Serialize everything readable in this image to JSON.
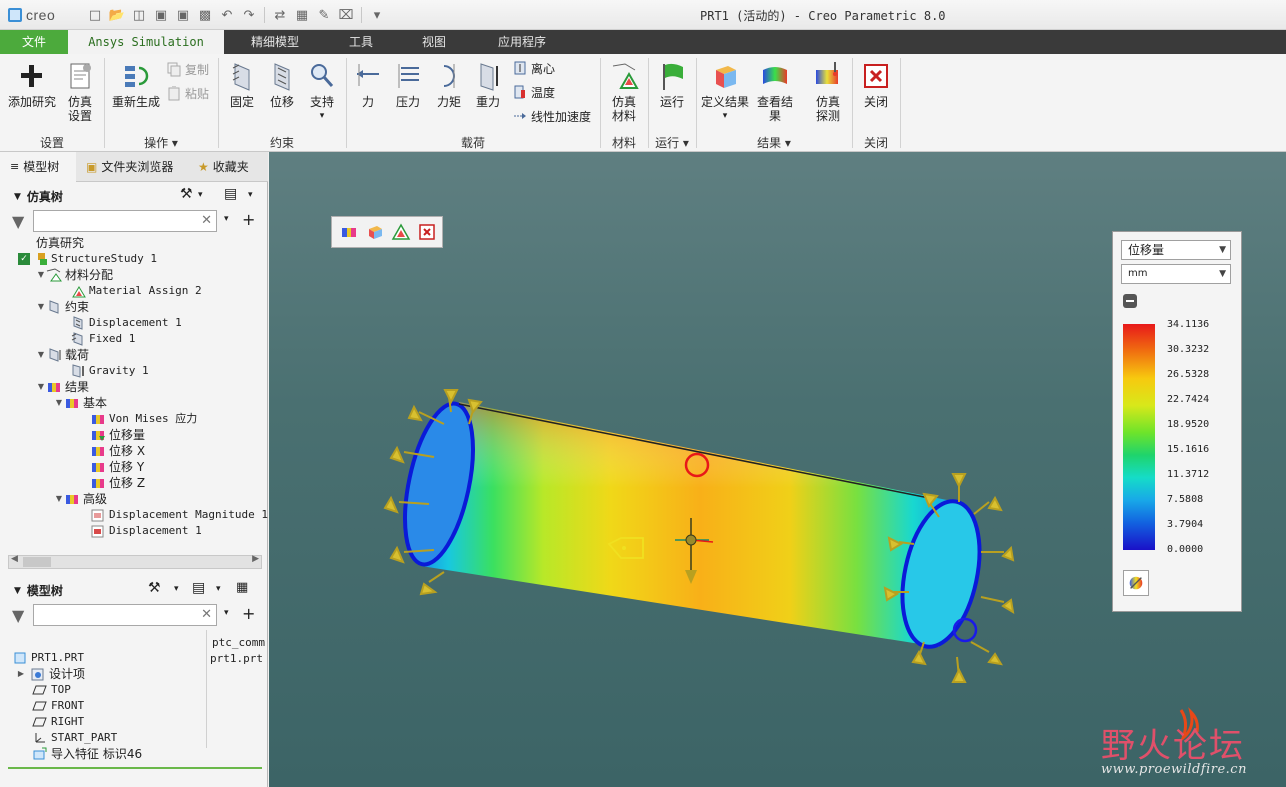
{
  "app": {
    "logo": "creo",
    "window_title": "PRT1 (活动的) - Creo Parametric 8.0"
  },
  "menu": {
    "tabs": [
      "文件",
      "Ansys Simulation",
      "精细模型",
      "工具",
      "视图",
      "应用程序"
    ]
  },
  "ribbon": {
    "add_study": "添加研究",
    "sim_setup_1": "仿真",
    "sim_setup_2": "设置",
    "copy": "复制",
    "paste": "粘贴",
    "regenerate": "重新生成",
    "fixed": "固定",
    "displacement": "位移",
    "support": "支持",
    "force": "力",
    "pressure": "压力",
    "moment": "力矩",
    "gravity": "重力",
    "centrifugal": "离心",
    "temperature": "温度",
    "linear_accel": "线性加速度",
    "sim_material_1": "仿真",
    "sim_material_2": "材料",
    "run": "运行",
    "define_results": "定义结果",
    "view_results_1": "查看结",
    "view_results_2": "果",
    "sim_probe_1": "仿真",
    "sim_probe_2": "探测",
    "close": "关闭",
    "groups": {
      "setup": "设置",
      "operations": "操作",
      "constraints": "约束",
      "loads": "载荷",
      "material": "材料",
      "run": "运行",
      "results": "结果",
      "close": "关闭"
    }
  },
  "nav": {
    "tab_model_tree": "模型树",
    "tab_folder": "文件夹浏览器",
    "tab_favorites": "收藏夹"
  },
  "sim_tree": {
    "title": "仿真树",
    "items": [
      "仿真研究",
      "StructureStudy 1",
      "材料分配",
      "Material Assign 2",
      "约束",
      "Displacement 1",
      "Fixed 1",
      "载荷",
      "Gravity 1",
      "结果",
      "基本",
      "Von Mises 应力",
      "位移量",
      "位移 X",
      "位移 Y",
      "位移 Z",
      "高级",
      "Displacement Magnitude 1",
      "Displacement 1"
    ]
  },
  "model_tree": {
    "title": "模型树",
    "column_header": "ptc_comm",
    "column_value": "prt1.prt",
    "items": [
      "PRT1.PRT",
      "设计项",
      "TOP",
      "FRONT",
      "RIGHT",
      "START_PART",
      "导入特征 标识46"
    ]
  },
  "legend": {
    "quantity": "位移量",
    "unit": "mm",
    "ticks": [
      "34.1136",
      "30.3232",
      "26.5328",
      "22.7424",
      "18.9520",
      "15.1616",
      "11.3712",
      "7.5808",
      "3.7904",
      "0.0000"
    ]
  },
  "watermark": {
    "name": "野火论坛",
    "url": "www.proewildfire.cn"
  }
}
